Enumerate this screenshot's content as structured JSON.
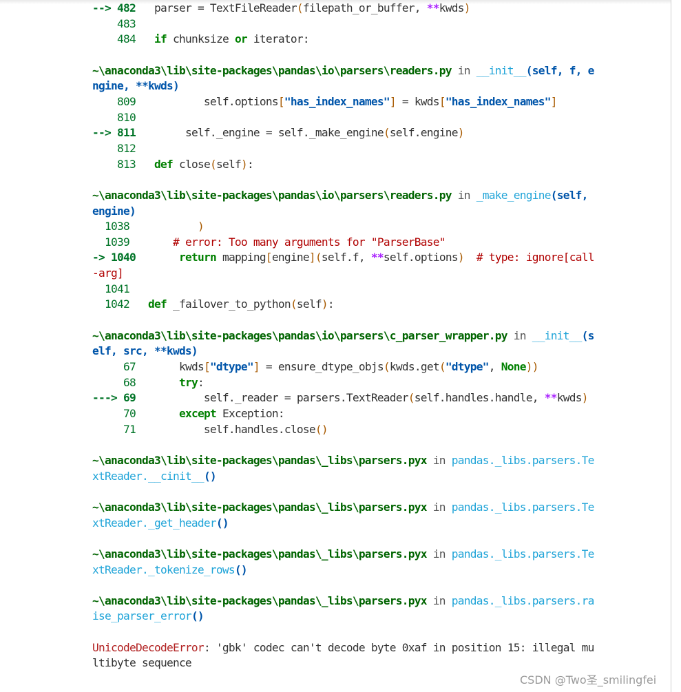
{
  "watermark": "CSDN @Two圣_smilingfei",
  "frames": [
    {
      "lines": [
        {
          "arrow": "--> ",
          "num": "482",
          "code": "   parser = TextFileReader(filepath_or_buffer, **kwds)"
        },
        {
          "arrow": "    ",
          "num": "483",
          "code": ""
        },
        {
          "arrow": "    ",
          "num": "484",
          "code": "   if chunksize or iterator:"
        }
      ]
    },
    {
      "path": "~\\anaconda3\\lib\\site-packages\\pandas\\io\\parsers\\readers.py",
      "in": " in ",
      "func": "__init__",
      "args": "(self, f, engine, **kwds)",
      "lines": [
        {
          "arrow": "    ",
          "num": "809",
          "code": "           self.options[\"has_index_names\"] = kwds[\"has_index_names\"]"
        },
        {
          "arrow": "    ",
          "num": "810",
          "code": ""
        },
        {
          "arrow": "--> ",
          "num": "811",
          "code": "        self._engine = self._make_engine(self.engine)"
        },
        {
          "arrow": "    ",
          "num": "812",
          "code": ""
        },
        {
          "arrow": "    ",
          "num": "813",
          "code": "   def close(self):"
        }
      ]
    },
    {
      "path": "~\\anaconda3\\lib\\site-packages\\pandas\\io\\parsers\\readers.py",
      "in": " in ",
      "func": "_make_engine",
      "args": "(self, engine)",
      "lines": [
        {
          "arrow": "  ",
          "num": "1038",
          "code": "           )"
        },
        {
          "arrow": "  ",
          "num": "1039",
          "code": "       # error: Too many arguments for \"ParserBase\""
        },
        {
          "arrow": "-> ",
          "num": "1040",
          "code": "       return mapping[engine](self.f, **self.options)  # type: ignore[call-arg]"
        },
        {
          "arrow": "  ",
          "num": "1041",
          "code": ""
        },
        {
          "arrow": "  ",
          "num": "1042",
          "code": "   def _failover_to_python(self):"
        }
      ]
    },
    {
      "path": "~\\anaconda3\\lib\\site-packages\\pandas\\io\\parsers\\c_parser_wrapper.py",
      "in": " in ",
      "func": "__init__",
      "args": "(self, src, **kwds)",
      "lines": [
        {
          "arrow": "     ",
          "num": "67",
          "code": "       kwds[\"dtype\"] = ensure_dtype_objs(kwds.get(\"dtype\", None))"
        },
        {
          "arrow": "     ",
          "num": "68",
          "code": "       try:"
        },
        {
          "arrow": "---> ",
          "num": "69",
          "code": "           self._reader = parsers.TextReader(self.handles.handle, **kwds)"
        },
        {
          "arrow": "     ",
          "num": "70",
          "code": "       except Exception:"
        },
        {
          "arrow": "     ",
          "num": "71",
          "code": "           self.handles.close()"
        }
      ]
    },
    {
      "path": "~\\anaconda3\\lib\\site-packages\\pandas\\_libs\\parsers.pyx",
      "in": " in ",
      "func": "pandas._libs.parsers.TextReader.__cinit__",
      "args": "()",
      "lines": []
    },
    {
      "path": "~\\anaconda3\\lib\\site-packages\\pandas\\_libs\\parsers.pyx",
      "in": " in ",
      "func": "pandas._libs.parsers.TextReader._get_header",
      "args": "()",
      "lines": []
    },
    {
      "path": "~\\anaconda3\\lib\\site-packages\\pandas\\_libs\\parsers.pyx",
      "in": " in ",
      "func": "pandas._libs.parsers.TextReader._tokenize_rows",
      "args": "()",
      "lines": []
    },
    {
      "path": "~\\anaconda3\\lib\\site-packages\\pandas\\_libs\\parsers.pyx",
      "in": " in ",
      "func": "pandas._libs.parsers.raise_parser_error",
      "args": "()",
      "lines": []
    }
  ],
  "error": {
    "name": "UnicodeDecodeError",
    "message": ": 'gbk' codec can't decode byte 0xaf in position 15: illegal multibyte sequence"
  }
}
